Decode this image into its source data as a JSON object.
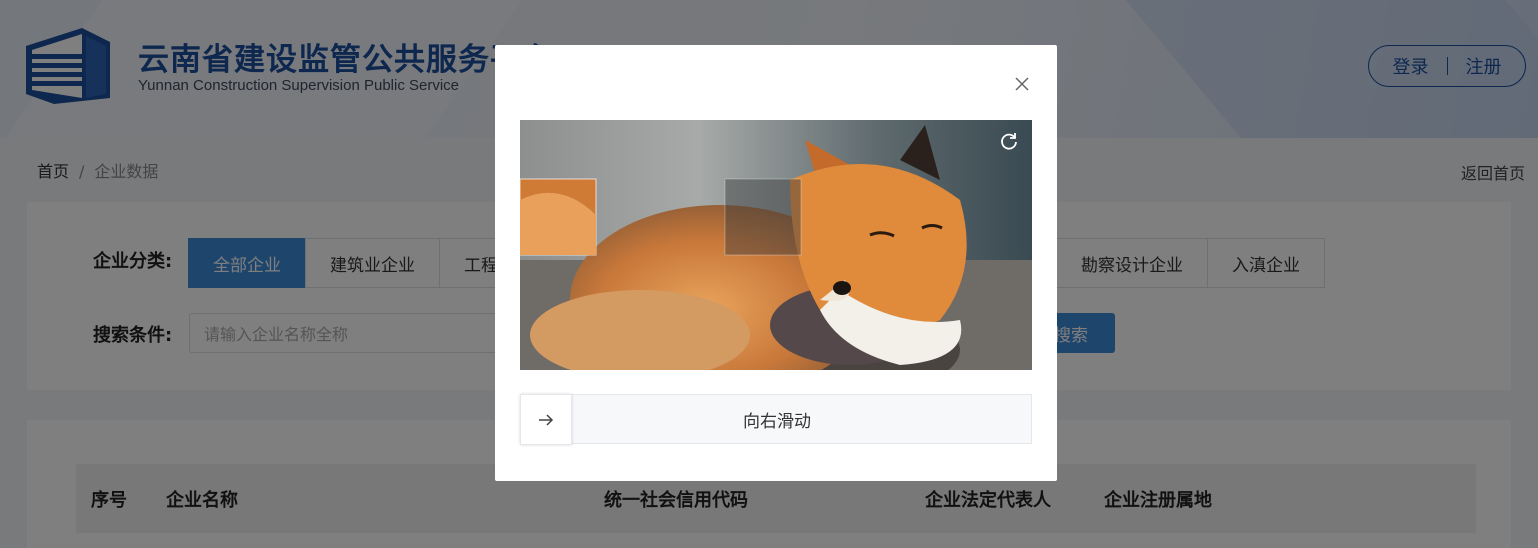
{
  "header": {
    "title": "云南省建设监管公共服务平台",
    "subtitle": "Yunnan Construction Supervision Public Service",
    "login": "登录",
    "register": "注册"
  },
  "breadcrumb": {
    "home": "首页",
    "separator": "/",
    "current": "企业数据",
    "back": "返回首页"
  },
  "filter": {
    "category_label": "企业分类:",
    "categories": [
      "全部企业",
      "建筑业企业",
      "工程"
    ],
    "categories_right": [
      "勘察设计企业",
      "入滇企业"
    ],
    "search_label": "搜索条件:",
    "search_placeholder": "请输入企业名称全称",
    "search_button": "搜索"
  },
  "table": {
    "headers": [
      "序号",
      "企业名称",
      "统一社会信用代码",
      "企业法定代表人",
      "企业注册属地"
    ]
  },
  "captcha": {
    "close_icon": "close-icon",
    "refresh_icon": "refresh-icon",
    "slider_text": "向右滑动",
    "handle_icon": "arrow-right-icon",
    "image": "fox-photo"
  },
  "colors": {
    "brand": "#1a4f9c",
    "accent": "#3c8ad9"
  }
}
